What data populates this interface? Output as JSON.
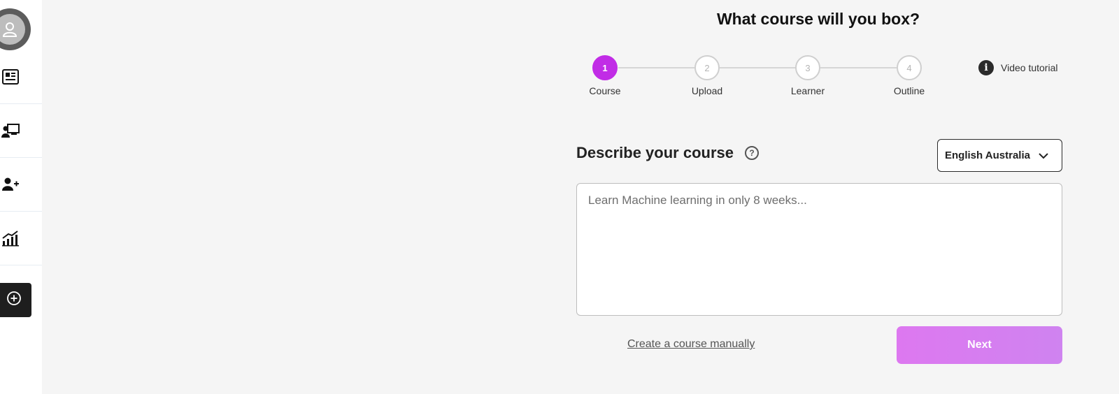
{
  "sidebar": {
    "items": [
      {
        "name": "news-icon"
      },
      {
        "name": "presenter-icon"
      },
      {
        "name": "add-user-icon"
      },
      {
        "name": "analytics-icon"
      }
    ],
    "create_icon": "plus-circle-icon"
  },
  "header": {
    "title": "What course will you box?"
  },
  "stepper": {
    "steps": [
      {
        "number": "1",
        "label": "Course",
        "active": true
      },
      {
        "number": "2",
        "label": "Upload",
        "active": false
      },
      {
        "number": "3",
        "label": "Learner",
        "active": false
      },
      {
        "number": "4",
        "label": "Outline",
        "active": false
      }
    ]
  },
  "video_tutorial": {
    "label": "Video tutorial",
    "icon": "info-icon"
  },
  "describe": {
    "title": "Describe your course",
    "help_icon": "help-icon",
    "language": "English Australia",
    "textarea_value": "",
    "textarea_placeholder": "Learn Machine learning in only 8 weeks..."
  },
  "actions": {
    "manual_link": "Create a course manually",
    "next_label": "Next"
  },
  "colors": {
    "accent": "#c12ce6",
    "next_button": "#dd78f0"
  }
}
